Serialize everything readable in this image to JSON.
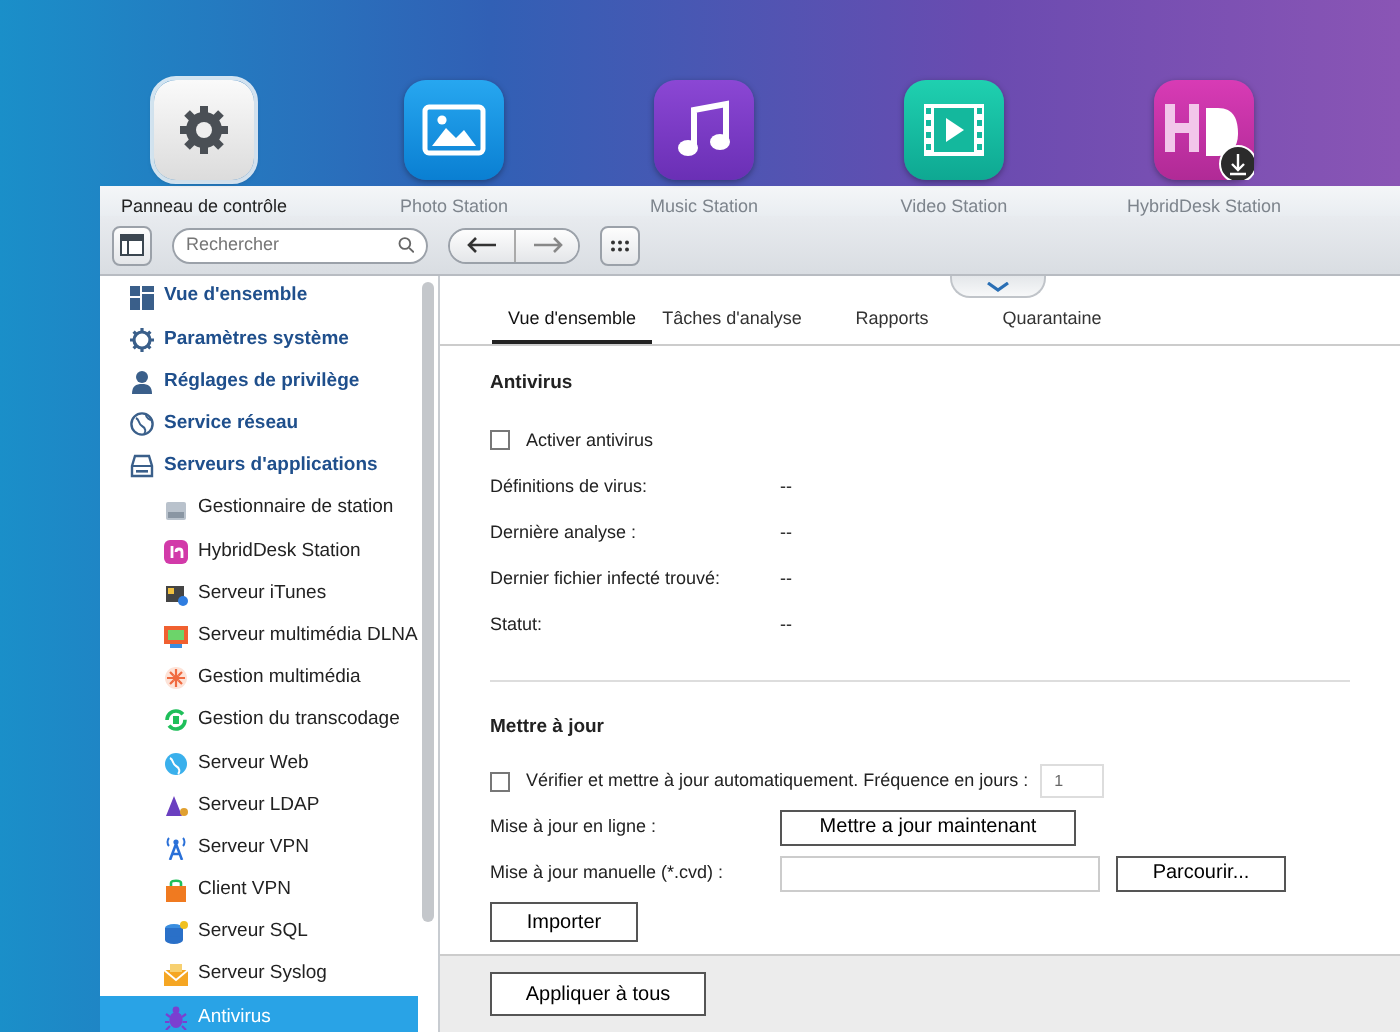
{
  "desktop_apps": [
    {
      "label": "Panneau de contrôle",
      "kind": "gear",
      "selected": true
    },
    {
      "label": "Photo Station",
      "kind": "photo",
      "selected": false
    },
    {
      "label": "Music Station",
      "kind": "music",
      "selected": false
    },
    {
      "label": "Video Station",
      "kind": "video",
      "selected": false
    },
    {
      "label": "HybridDesk Station",
      "kind": "hd",
      "selected": false
    }
  ],
  "toolbar": {
    "search_placeholder": "Rechercher"
  },
  "sidebar": {
    "items": [
      {
        "label": "Vue d'ensemble",
        "kind": "overview",
        "selected": false
      },
      {
        "label": "Paramètres système",
        "kind": "gear",
        "selected": false
      },
      {
        "label": "Réglages de privilège",
        "kind": "user",
        "selected": false
      },
      {
        "label": "Service réseau",
        "kind": "globe",
        "selected": false
      },
      {
        "label": "Serveurs d'applications",
        "kind": "server",
        "selected": false,
        "children": [
          {
            "label": "Gestionnaire de station",
            "kind": "station",
            "selected": false
          },
          {
            "label": "HybridDesk Station",
            "kind": "hybriddesk",
            "selected": false
          },
          {
            "label": "Serveur iTunes",
            "kind": "itunes",
            "selected": false
          },
          {
            "label": "Serveur multimédia DLNA",
            "kind": "dlna",
            "selected": false
          },
          {
            "label": "Gestion multimédia",
            "kind": "media",
            "selected": false
          },
          {
            "label": "Gestion du transcodage",
            "kind": "transcode",
            "selected": false
          },
          {
            "label": "Serveur Web",
            "kind": "web",
            "selected": false
          },
          {
            "label": "Serveur LDAP",
            "kind": "ldap",
            "selected": false
          },
          {
            "label": "Serveur VPN",
            "kind": "vpnserver",
            "selected": false
          },
          {
            "label": "Client VPN",
            "kind": "vpnclient",
            "selected": false
          },
          {
            "label": "Serveur SQL",
            "kind": "sql",
            "selected": false
          },
          {
            "label": "Serveur Syslog",
            "kind": "syslog",
            "selected": false
          },
          {
            "label": "Antivirus",
            "kind": "antivirus",
            "selected": true
          }
        ]
      }
    ]
  },
  "tabs": [
    {
      "label": "Vue d'ensemble",
      "selected": true
    },
    {
      "label": "Tâches d'analyse",
      "selected": false
    },
    {
      "label": "Rapports",
      "selected": false
    },
    {
      "label": "Quarantaine",
      "selected": false
    }
  ],
  "antivirus": {
    "title": "Antivirus",
    "enable": {
      "label": "Activer antivirus",
      "checked": false
    },
    "rows": [
      {
        "label": "Définitions de virus:",
        "value": "--"
      },
      {
        "label": "Dernière analyse :",
        "value": "--"
      },
      {
        "label": "Dernier fichier infecté trouvé:",
        "value": "--"
      },
      {
        "label": "Statut:",
        "value": "--"
      }
    ]
  },
  "update": {
    "title": "Mettre à jour",
    "auto": {
      "label": "Vérifier et mettre à jour automatiquement. Fréquence en jours :",
      "checked": false,
      "value": "1"
    },
    "online": {
      "label": "Mise à jour en ligne :",
      "button": "Mettre a jour maintenant"
    },
    "manual": {
      "label": "Mise à jour manuelle (*.cvd) :",
      "button": "Parcourir..."
    },
    "import_button": "Importer"
  },
  "footer": {
    "button": "Appliquer à tous"
  }
}
